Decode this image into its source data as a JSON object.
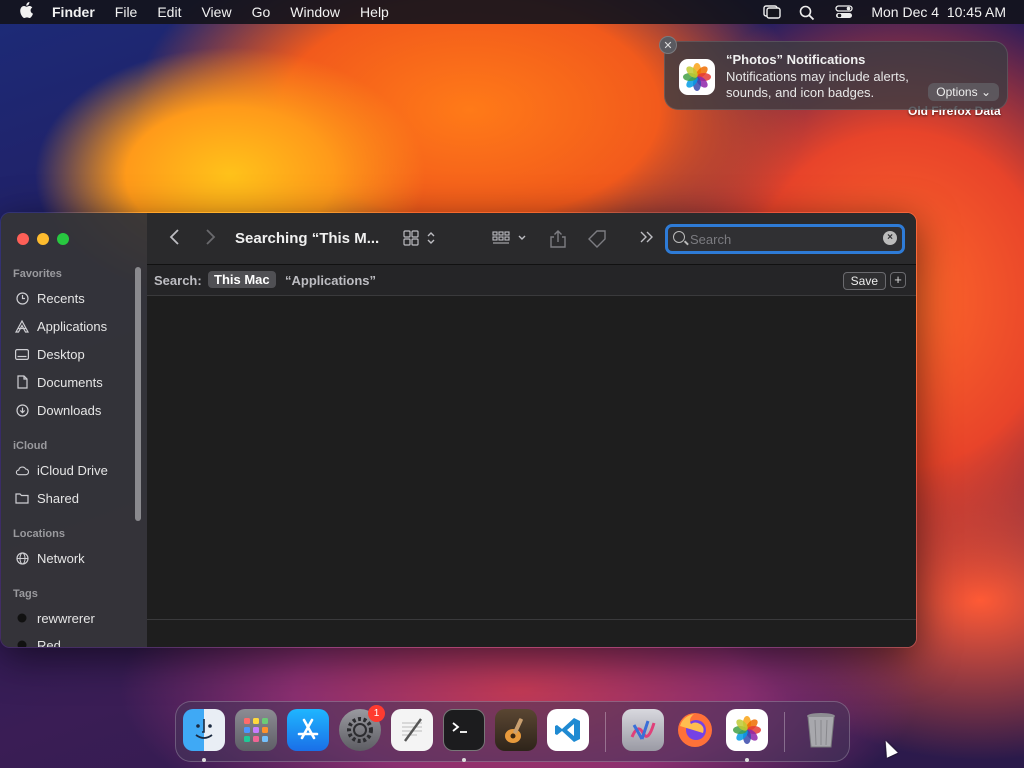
{
  "menubar": {
    "app_name": "Finder",
    "menus": [
      "File",
      "Edit",
      "View",
      "Go",
      "Window",
      "Help"
    ],
    "datetime": "Mon Dec 4  10:45 AM"
  },
  "notification": {
    "title": "“Photos” Notifications",
    "body": "Notifications may include alerts, sounds, and icon badges.",
    "options_label": "Options ⌄",
    "close_label": "✕"
  },
  "desktop": {
    "item_label": "Old Firefox Data"
  },
  "finder": {
    "title": "Searching “This M...",
    "search_placeholder": "Search",
    "scope_label": "Search:",
    "scope_this_mac": "This Mac",
    "scope_applications": "“Applications”",
    "save_label": "Save",
    "add_label": "+",
    "sidebar": {
      "favorites_header": "Favorites",
      "favorites": [
        "Recents",
        "Applications",
        "Desktop",
        "Documents",
        "Downloads"
      ],
      "icloud_header": "iCloud",
      "icloud": [
        "iCloud Drive",
        "Shared"
      ],
      "locations_header": "Locations",
      "locations": [
        "Network"
      ],
      "tags_header": "Tags",
      "tags": [
        "rewwrerer",
        "Red"
      ]
    }
  },
  "dock": {
    "apps": [
      "Finder",
      "Launchpad",
      "App Store",
      "System Settings",
      "TextEdit",
      "Terminal",
      "GarageBand",
      "Visual Studio Code",
      "Instruments",
      "Firefox",
      "Photos",
      "Trash"
    ],
    "settings_badge": "1"
  },
  "colors": {
    "accent": "#2e7bd6",
    "close": "#fe5f57",
    "minimize": "#febc2e",
    "zoom": "#28c840",
    "badge": "#ff3b30"
  }
}
